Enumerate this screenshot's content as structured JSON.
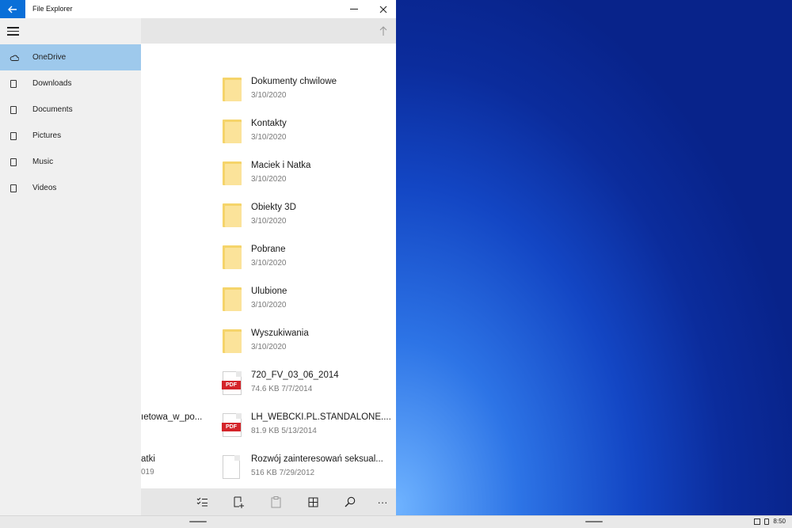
{
  "window": {
    "title": "File Explorer",
    "back_icon": "arrow-left-icon",
    "minimize_icon": "minimize-icon",
    "close_icon": "close-icon",
    "accent": "#0a6fd8"
  },
  "addressbar": {
    "up_icon": "arrow-up-icon"
  },
  "sidebar": {
    "menu_icon": "hamburger-icon",
    "items": [
      {
        "label": "OneDrive",
        "icon": "cloud-icon",
        "active": true
      },
      {
        "label": "Downloads",
        "icon": "device-icon"
      },
      {
        "label": "Documents",
        "icon": "device-icon"
      },
      {
        "label": "Pictures",
        "icon": "device-icon"
      },
      {
        "label": "Music",
        "icon": "device-icon"
      },
      {
        "label": "Videos",
        "icon": "device-icon"
      }
    ]
  },
  "files": [
    {
      "name": "Dokumenty chwilowe",
      "meta": "3/10/2020",
      "type": "folder"
    },
    {
      "name": "Kontakty",
      "meta": "3/10/2020",
      "type": "folder"
    },
    {
      "name": "Maciek i Natka",
      "meta": "3/10/2020",
      "type": "folder"
    },
    {
      "name": "Obiekty 3D",
      "meta": "3/10/2020",
      "type": "folder"
    },
    {
      "name": "Pobrane",
      "meta": "3/10/2020",
      "type": "folder"
    },
    {
      "name": "Ulubione",
      "meta": "3/10/2020",
      "type": "folder"
    },
    {
      "name": "Wyszukiwania",
      "meta": "3/10/2020",
      "type": "folder"
    },
    {
      "name": "720_FV_03_06_2014",
      "meta": "74.6 KB 7/7/2014",
      "type": "pdf",
      "badge": "PDF"
    },
    {
      "name": "LH_WEBCKI.PL.STANDALONE....",
      "meta": "81.9 KB 5/13/2014",
      "type": "pdf",
      "badge": "PDF"
    },
    {
      "name": "Rozwój zainteresowań seksual...",
      "meta": "516 KB 7/29/2012",
      "type": "doc"
    }
  ],
  "behind_items": [
    {
      "name": "ıetowa_w_po...",
      "meta": ""
    },
    {
      "name": "atki",
      "meta": "019"
    }
  ],
  "commandbar": {
    "icons": [
      "select-list-icon",
      "new-item-icon",
      "paste-icon",
      "view-icon",
      "search-icon",
      "more-icon"
    ],
    "more_label": "···"
  },
  "taskbar": {
    "time": "8:50"
  }
}
